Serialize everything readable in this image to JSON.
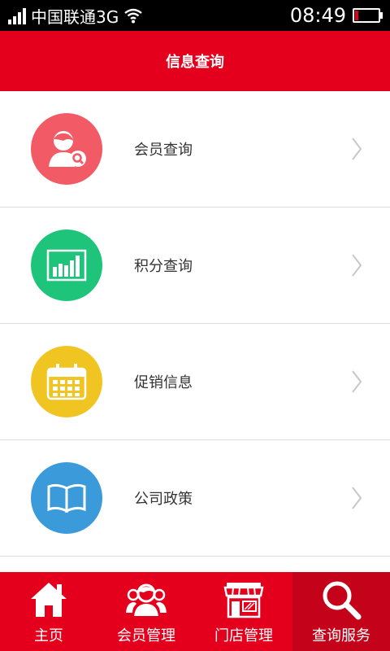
{
  "status_bar": {
    "carrier": "中国联通3G",
    "time": "08:49"
  },
  "header": {
    "title": "信息查询"
  },
  "menu": {
    "items": [
      {
        "label": "会员查询",
        "color": "#f25a65",
        "icon": "member-search-icon"
      },
      {
        "label": "积分查询",
        "color": "#1dc47a",
        "icon": "bar-chart-icon"
      },
      {
        "label": "促销信息",
        "color": "#f1c521",
        "icon": "calendar-icon"
      },
      {
        "label": "公司政策",
        "color": "#3b9ad9",
        "icon": "book-icon"
      }
    ]
  },
  "tabbar": {
    "tabs": [
      {
        "label": "主页",
        "icon": "home-icon"
      },
      {
        "label": "会员管理",
        "icon": "members-icon"
      },
      {
        "label": "门店管理",
        "icon": "store-icon"
      },
      {
        "label": "查询服务",
        "icon": "search-icon",
        "active": true
      }
    ]
  },
  "colors": {
    "brand_red": "#e4001d",
    "active_tab": "#c4021a"
  }
}
